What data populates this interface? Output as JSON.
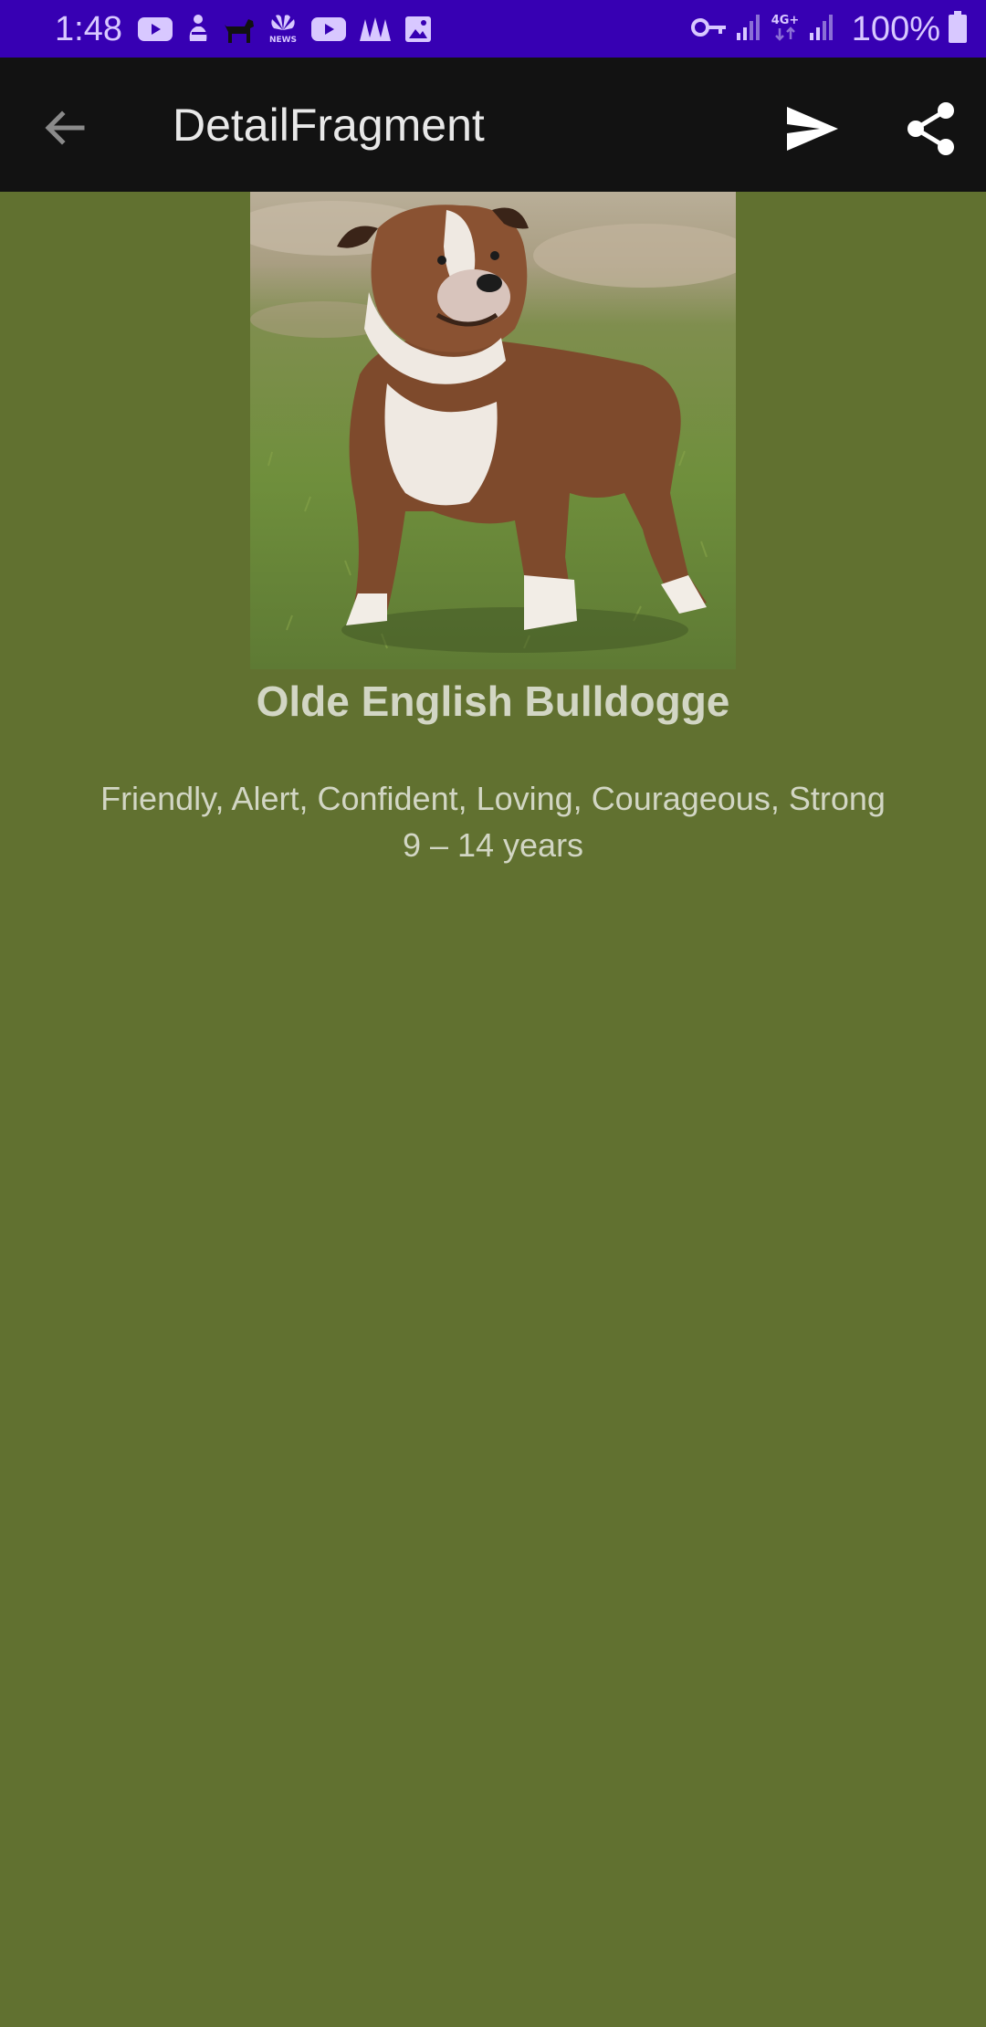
{
  "status_bar": {
    "time": "1:48",
    "battery": "100%",
    "network": "4G+",
    "notification_icons": [
      "youtube-icon",
      "figure-icon",
      "dog-icon",
      "nbc-news-icon",
      "youtube-icon",
      "app-icon",
      "gallery-icon"
    ],
    "system_icons": [
      "vpn-key-icon",
      "signal-icon",
      "signal-icon",
      "battery-icon"
    ]
  },
  "app_bar": {
    "title": "DetailFragment",
    "back_icon": "arrow-back-icon",
    "send_icon": "send-icon",
    "share_icon": "share-icon"
  },
  "detail": {
    "breed_name": "Olde English Bulldogge",
    "temperament": "Friendly, Alert, Confident, Loving, Courageous, Strong",
    "life_span": "9 – 14 years"
  },
  "colors": {
    "status_bar": "#3700b3",
    "app_bar": "#121212",
    "background": "#617130",
    "text": "#d2d6c4"
  }
}
